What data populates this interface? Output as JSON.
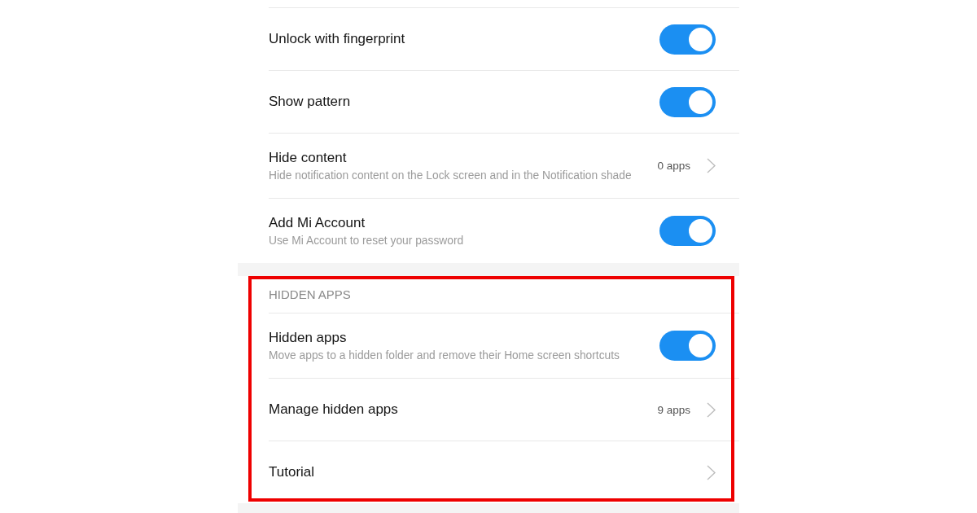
{
  "sections": [
    {
      "rows": [
        {
          "kind": "toggle",
          "title": "Unlock with fingerprint",
          "on": true
        },
        {
          "kind": "toggle",
          "title": "Show pattern",
          "on": true
        },
        {
          "kind": "link",
          "title": "Hide content",
          "subtitle": "Hide notification content on the Lock screen and in the Notification shade",
          "value": "0 apps"
        },
        {
          "kind": "toggle",
          "title": "Add Mi Account",
          "subtitle": "Use Mi Account to reset your password",
          "on": true
        }
      ]
    },
    {
      "header": "HIDDEN APPS",
      "highlighted": true,
      "rows": [
        {
          "kind": "toggle",
          "title": "Hidden apps",
          "subtitle": "Move apps to a hidden folder and remove their Home screen shortcuts",
          "on": true
        },
        {
          "kind": "link",
          "title": "Manage hidden apps",
          "value": "9 apps"
        },
        {
          "kind": "link",
          "title": "Tutorial"
        }
      ]
    }
  ]
}
